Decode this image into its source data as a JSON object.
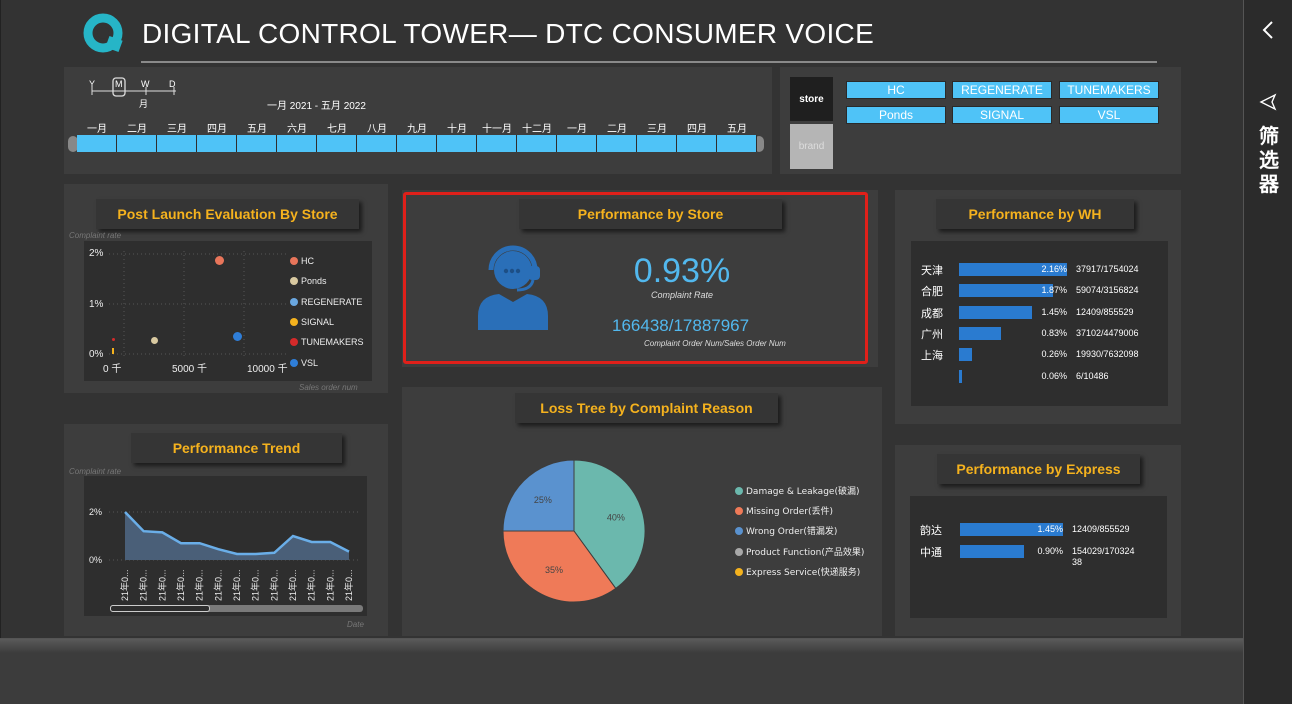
{
  "header": {
    "title": "DIGITAL CONTROL TOWER— DTC CONSUMER VOICE"
  },
  "timeline": {
    "scale": {
      "y": "Y",
      "m": "M",
      "w": "W",
      "d": "D",
      "selected": "月"
    },
    "range": "一月 2021 - 五月 2022",
    "months": [
      "一月",
      "二月",
      "三月",
      "四月",
      "五月",
      "六月",
      "七月",
      "八月",
      "九月",
      "十月",
      "十一月",
      "十二月",
      "一月",
      "二月",
      "三月",
      "四月",
      "五月"
    ]
  },
  "slicer": {
    "tabs": [
      {
        "label": "store"
      },
      {
        "label": "brand"
      }
    ],
    "stores": [
      "HC",
      "REGENERATE",
      "TUNEMAKERS",
      "Ponds",
      "SIGNAL",
      "VSL"
    ]
  },
  "post_launch": {
    "title": "Post Launch Evaluation By Store",
    "y_title": "Complaint rate",
    "x_title": "Sales order num",
    "y_ticks": [
      "2%",
      "1%",
      "0%"
    ],
    "x_ticks": [
      "0 千",
      "5000 千",
      "10000 千"
    ],
    "legend": [
      {
        "label": "HC",
        "color": "#e8755a"
      },
      {
        "label": "Ponds",
        "color": "#d9c9a0"
      },
      {
        "label": "REGENERATE",
        "color": "#6aa7e0"
      },
      {
        "label": "SIGNAL",
        "color": "#f4b21e"
      },
      {
        "label": "TUNEMAKERS",
        "color": "#d42a2a"
      },
      {
        "label": "VSL",
        "color": "#2f7ed8"
      }
    ]
  },
  "performance_store": {
    "title": "Performance by Store",
    "rate": "0.93%",
    "rate_label": "Complaint Rate",
    "ratio": "166438/17887967",
    "ratio_label": "Complaint Order Num/Sales Order Num",
    "icon": "customer-service-agent-icon"
  },
  "performance_wh": {
    "title": "Performance by WH",
    "rows": [
      {
        "label": "天津",
        "pct": "2.16%",
        "count": "37917/1754024",
        "value": 2.16
      },
      {
        "label": "合肥",
        "pct": "1.87%",
        "count": "59074/3156824",
        "value": 1.87
      },
      {
        "label": "成都",
        "pct": "1.45%",
        "count": "12409/855529",
        "value": 1.45
      },
      {
        "label": "广州",
        "pct": "0.83%",
        "count": "37102/4479006",
        "value": 0.83
      },
      {
        "label": "上海",
        "pct": "0.26%",
        "count": "19930/7632098",
        "value": 0.26
      },
      {
        "label": "",
        "pct": "0.06%",
        "count": "6/10486",
        "value": 0.06
      }
    ]
  },
  "performance_trend": {
    "title": "Performance Trend",
    "y_title": "Complaint rate",
    "x_title": "Date",
    "y_ticks": [
      "2%",
      "0%"
    ],
    "x_label": "21年0...",
    "values": [
      2.0,
      1.2,
      1.15,
      0.7,
      0.7,
      0.45,
      0.25,
      0.25,
      0.3,
      1.0,
      0.75,
      0.75,
      0.35
    ]
  },
  "loss_tree": {
    "title": "Loss Tree by Complaint Reason",
    "slices": [
      {
        "label": "Damage & Leakage(破漏)",
        "value": 40,
        "text": "40%",
        "color": "#6bb8ad"
      },
      {
        "label": "Missing Order(丢件)",
        "value": 35,
        "text": "35%",
        "color": "#ef7a58"
      },
      {
        "label": "Wrong Order(错漏发)",
        "value": 25,
        "text": "25%",
        "color": "#5a92cf"
      },
      {
        "label": "Product Function(产品效果)",
        "value": 0,
        "text": "",
        "color": "#a8a8a8"
      },
      {
        "label": "Express Service(快递服务)",
        "value": 0,
        "text": "",
        "color": "#f4b21e"
      }
    ]
  },
  "performance_express": {
    "title": "Performance by Express",
    "rows": [
      {
        "label": "韵达",
        "pct": "1.45%",
        "count": "12409/855529",
        "value": 1.45
      },
      {
        "label": "中通",
        "pct": "0.90%",
        "count": "154029/170324 38",
        "value": 0.9
      }
    ]
  },
  "filter_pane": {
    "label": "筛选器"
  }
}
